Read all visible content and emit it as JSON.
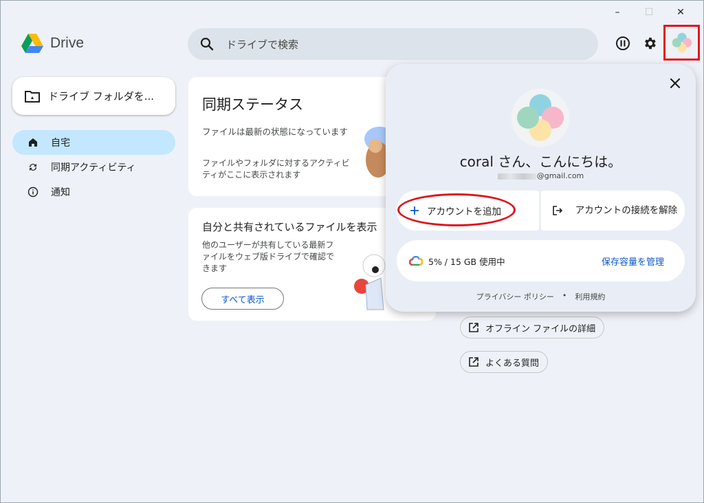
{
  "window": {
    "minimize": "–",
    "maximize": "☐",
    "close": "✕"
  },
  "app": {
    "name": "Drive"
  },
  "search": {
    "placeholder": "ドライブで検索"
  },
  "sidebar": {
    "new_button": "ドライブ フォルダを...",
    "items": [
      {
        "label": "自宅",
        "icon": "home-icon",
        "active": true
      },
      {
        "label": "同期アクティビティ",
        "icon": "sync-icon",
        "active": false
      },
      {
        "label": "通知",
        "icon": "info-icon",
        "active": false
      }
    ]
  },
  "sync_card": {
    "title": "同期ステータス",
    "status": "ファイルは最新の状態になっています",
    "description": "ファイルやフォルダに対するアクティビティがここに表示されます"
  },
  "shared_card": {
    "title": "自分と共有されているファイルを表示",
    "description": "他のユーザーが共有している最新ファイルをウェブ版ドライブで確認できます",
    "button": "すべて表示"
  },
  "help_links": [
    {
      "label": "オフライン ファイルの詳細",
      "icon": "open-external-icon"
    },
    {
      "label": "よくある質問",
      "icon": "open-external-icon"
    }
  ],
  "account_popup": {
    "greeting": "coral さん、こんにちは。",
    "email_visible": "@gmail.com",
    "add_account": "アカウントを追加",
    "disconnect": "アカウントの接続を解除",
    "storage": "5% / 15 GB 使用中",
    "manage_storage": "保存容量を管理",
    "privacy": "プライバシー ポリシー",
    "separator": "•",
    "terms": "利用規約"
  },
  "colors": {
    "accent": "#0b57d0",
    "active_nav": "#c2e7ff",
    "highlight": "#e3161d",
    "background": "#eef2f8"
  }
}
